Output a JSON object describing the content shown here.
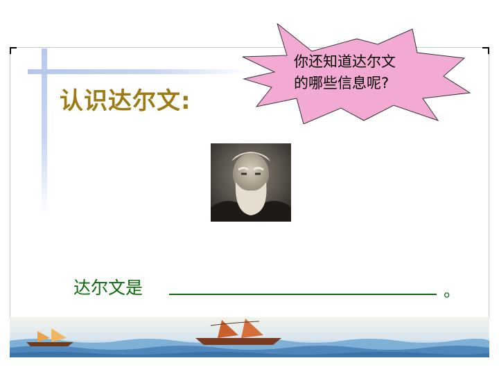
{
  "title": "认识达尔文:",
  "callout": {
    "line1": "你还知道达尔文",
    "line2": "的哪些信息呢?",
    "fill_color": "#f2a9d2"
  },
  "portrait": {
    "subject": "Charles Darwin portrait",
    "icon": "portrait-photo"
  },
  "prompt": {
    "text": "达尔文是",
    "end_mark": "。"
  },
  "colors": {
    "title": "#9c7a14",
    "prompt": "#0a6a0a",
    "accent_blue": "#b8c8ec"
  },
  "footer": {
    "decoration": "sea-with-sailing-ships"
  }
}
